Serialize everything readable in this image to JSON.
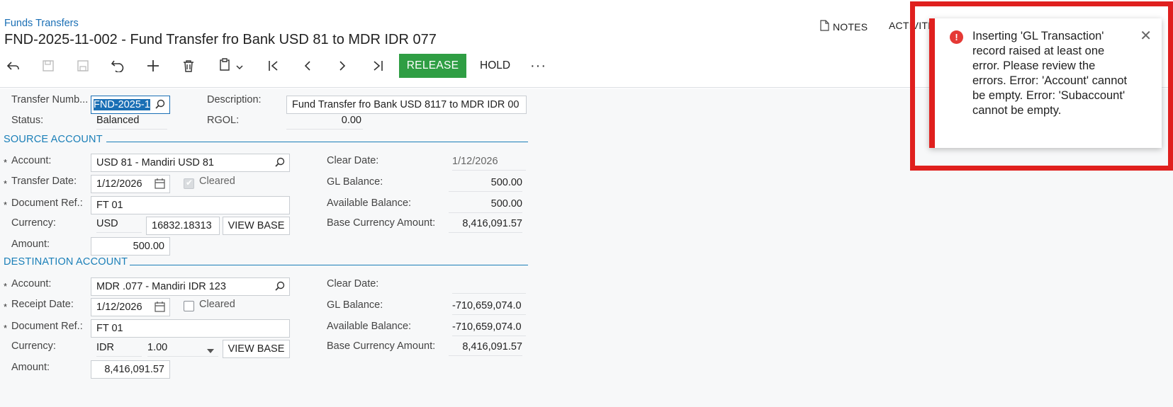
{
  "header": {
    "breadcrumb": "Funds Transfers",
    "title": "FND-2025-11-002 - Fund Transfer fro Bank USD 81     to MDR IDR   077",
    "notes_label": "NOTES",
    "activities_label": "ACTIVITIES"
  },
  "toolbar": {
    "release_label": "RELEASE",
    "hold_label": "HOLD",
    "more_label": "···"
  },
  "summary": {
    "transfer_number_label": "Transfer Numb...",
    "transfer_number_value": "FND-2025-1",
    "description_label": "Description:",
    "description_value": "Fund Transfer fro Bank USD 8117 to MDR IDR 00",
    "status_label": "Status:",
    "status_value": "Balanced",
    "rgol_label": "RGOL:",
    "rgol_value": "0.00"
  },
  "source": {
    "section_title": "SOURCE ACCOUNT",
    "account_label": "Account:",
    "account_value": "USD 81     - Mandiri USD 81",
    "transfer_date_label": "Transfer Date:",
    "transfer_date_value": "1/12/2026",
    "cleared_label": "Cleared",
    "document_ref_label": "Document Ref.:",
    "document_ref_value": "FT 01",
    "currency_label": "Currency:",
    "currency_value": "USD",
    "rate_value": "16832.18313",
    "view_base_label": "VIEW BASE",
    "amount_label": "Amount:",
    "amount_value": "500.00",
    "clear_date_label": "Clear Date:",
    "clear_date_value": "1/12/2026",
    "gl_balance_label": "GL Balance:",
    "gl_balance_value": "500.00",
    "available_balance_label": "Available Balance:",
    "available_balance_value": "500.00",
    "base_currency_amount_label": "Base Currency Amount:",
    "base_currency_amount_value": "8,416,091.57"
  },
  "destination": {
    "section_title": "DESTINATION ACCOUNT",
    "account_label": "Account:",
    "account_value": "MDR  .077 - Mandiri IDR 123",
    "receipt_date_label": "Receipt Date:",
    "receipt_date_value": "1/12/2026",
    "cleared_label": "Cleared",
    "document_ref_label": "Document Ref.:",
    "document_ref_value": "FT 01",
    "currency_label": "Currency:",
    "currency_value": "IDR",
    "rate_value": "1.00",
    "view_base_label": "VIEW BASE",
    "amount_label": "Amount:",
    "amount_value": "8,416,091.57",
    "clear_date_label": "Clear Date:",
    "clear_date_value": "",
    "gl_balance_label": "GL Balance:",
    "gl_balance_value": "-710,659,074.0",
    "available_balance_label": "Available Balance:",
    "available_balance_value": "-710,659,074.0",
    "base_currency_amount_label": "Base Currency Amount:",
    "base_currency_amount_value": "8,416,091.57"
  },
  "required_marker": "*",
  "alert": {
    "message": "Inserting  'GL Transaction' record raised at least one error. Please review the errors. Error: 'Account' cannot be empty. Error: 'Subaccount' cannot be empty.",
    "icon": "!",
    "close_icon": "✕",
    "accent_color": "#e0201e"
  },
  "colors": {
    "link": "#1a6fb5",
    "section": "#1a7fb8",
    "release": "#2f9e44"
  }
}
